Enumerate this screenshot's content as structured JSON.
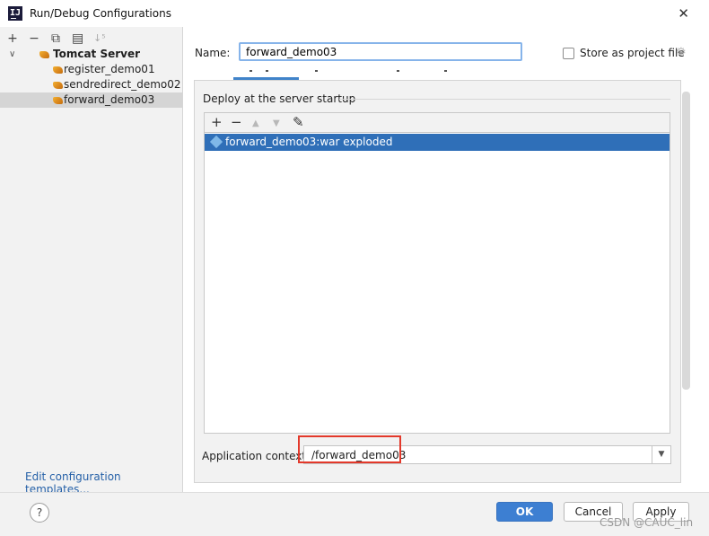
{
  "window": {
    "title": "Run/Debug Configurations",
    "close_glyph": "✕"
  },
  "sidebar": {
    "toolbar": [
      "+",
      "−",
      "⧉",
      "▤",
      "↓⁵"
    ],
    "group": {
      "label": "Tomcat Server",
      "expanded": true
    },
    "items": [
      {
        "label": "register_demo01",
        "selected": false
      },
      {
        "label": "sendredirect_demo02",
        "selected": false
      },
      {
        "label": "forward_demo03",
        "selected": true
      }
    ],
    "edit_templates_link": "Edit configuration templates..."
  },
  "config": {
    "name_label": "Name:",
    "name_value": "forward_demo03",
    "store_label": "Store as project file",
    "store_checked": false
  },
  "deploy": {
    "section_title": "Deploy at the server startup",
    "toolbar": {
      "add": "+",
      "remove": "−",
      "up": "▲",
      "down": "▼",
      "edit": "✎"
    },
    "items": [
      {
        "label": "forward_demo03:war exploded",
        "selected": true
      }
    ],
    "context_label": "Application context:",
    "context_value": "/forward_demo03",
    "dropdown_glyph": "▼"
  },
  "footer": {
    "help": "?",
    "ok": "OK",
    "cancel": "Cancel",
    "apply": "Apply",
    "watermark": "CSDN @CAUC_lin"
  },
  "colors": {
    "accent": "#3d7fd2",
    "selection": "#2f6fb8",
    "highlight": "#e3392b",
    "link": "#2661a8"
  }
}
